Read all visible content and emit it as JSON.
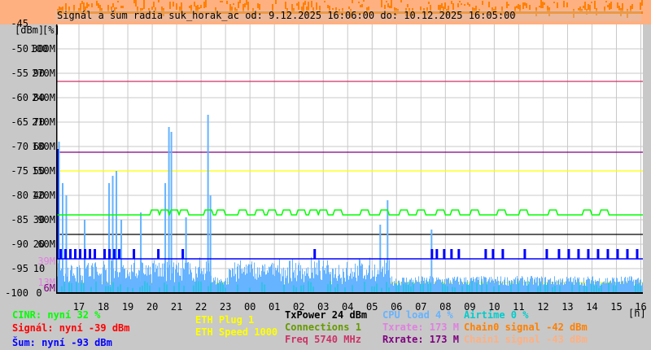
{
  "chart_data": {
    "type": "line",
    "title": "Signál a šum radia suk_horak_ac od: 9.12.2025 16:06:00 do: 10.12.2025 16:05:00",
    "axis_units": {
      "dbm": "[dBm]",
      "percent": "[%]",
      "x": "[h]"
    },
    "ylim_dbm": [
      -100,
      -45
    ],
    "ylim_percent": [
      0,
      110
    ],
    "ylim_rate_M": [
      0,
      330
    ],
    "y_ticks": [
      {
        "dbm": "-45",
        "pct": "",
        "rate": ""
      },
      {
        "dbm": "-50",
        "pct": "100",
        "rate": "300M"
      },
      {
        "dbm": "-55",
        "pct": "90",
        "rate": "270M"
      },
      {
        "dbm": "-60",
        "pct": "80",
        "rate": "240M"
      },
      {
        "dbm": "-65",
        "pct": "70",
        "rate": "210M"
      },
      {
        "dbm": "-70",
        "pct": "60",
        "rate": "180M"
      },
      {
        "dbm": "-75",
        "pct": "50",
        "rate": "150M"
      },
      {
        "dbm": "-80",
        "pct": "40",
        "rate": "120M"
      },
      {
        "dbm": "-85",
        "pct": "30",
        "rate": "90M"
      },
      {
        "dbm": "-90",
        "pct": "20",
        "rate": "60M"
      },
      {
        "dbm": "-95",
        "pct": "10",
        "rate": ""
      },
      {
        "dbm": "-100",
        "pct": "0",
        "rate": ""
      }
    ],
    "extra_rate_labels": [
      {
        "value": 39,
        "label": "39M",
        "color": "#e080e0"
      },
      {
        "value": 13,
        "label": "13M",
        "color": "#e080e0"
      },
      {
        "value": 6,
        "label": "6M",
        "color": "#800080"
      }
    ],
    "x_ticks": [
      "17",
      "18",
      "19",
      "20",
      "21",
      "22",
      "23",
      "00",
      "01",
      "02",
      "03",
      "04",
      "05",
      "06",
      "07",
      "08",
      "09",
      "10",
      "11",
      "12",
      "13",
      "14",
      "15",
      "16"
    ],
    "x_start_hour": 16.1,
    "x_end_hour": 40.083,
    "grid": true,
    "series": [
      {
        "name": "CINR",
        "unit": "%",
        "color": "#00ff00",
        "base": 32,
        "bumps_to": 34,
        "bump_hours": [
          19.9,
          20.3,
          20.7,
          21.1,
          22.1,
          22.6,
          23.5,
          24.2,
          24.7,
          25.3,
          25.9,
          26.4,
          26.8,
          27.4,
          28.5,
          29.3,
          30.1,
          30.8,
          31.6,
          32.2,
          33.0,
          34.1,
          35.0,
          36.2,
          37.6,
          38.3
        ]
      },
      {
        "name": "Šum",
        "unit": "dBm",
        "color": "#0000ff",
        "base": -93,
        "spike_to": -91,
        "spike_hours": [
          16.2,
          16.4,
          16.6,
          16.8,
          17.0,
          17.2,
          17.4,
          17.6,
          18.0,
          18.2,
          18.4,
          18.6,
          19.2,
          20.2,
          21.2,
          26.6,
          31.4,
          31.6,
          31.9,
          32.2,
          32.5,
          33.6,
          33.9,
          34.3,
          35.2,
          36.1,
          36.6,
          37.0,
          37.4,
          37.8,
          38.2,
          38.6,
          39.0,
          39.4,
          39.8
        ]
      },
      {
        "name": "CPU load",
        "unit": "%",
        "color": "#66b3ff",
        "base": 4,
        "spikes": [
          [
            16.15,
            62
          ],
          [
            16.3,
            45
          ],
          [
            16.45,
            40
          ],
          [
            17.2,
            30
          ],
          [
            18.2,
            45
          ],
          [
            18.35,
            48
          ],
          [
            18.5,
            50
          ],
          [
            18.7,
            30
          ],
          [
            19.5,
            33
          ],
          [
            20.5,
            45
          ],
          [
            20.65,
            68
          ],
          [
            20.75,
            66
          ],
          [
            21.35,
            31
          ],
          [
            22.25,
            73
          ],
          [
            22.35,
            40
          ],
          [
            29.3,
            28
          ],
          [
            29.6,
            38
          ],
          [
            31.4,
            26
          ]
        ]
      },
      {
        "name": "Airtime",
        "unit": "%",
        "color": "#00cccc",
        "base": 2
      },
      {
        "name": "Rxrate",
        "unit": "M",
        "color": "#800080",
        "value": 173
      },
      {
        "name": "Txrate",
        "unit": "M",
        "color": "#e080e0",
        "value": 173
      },
      {
        "name": "Freq",
        "unit": "MHz",
        "color": "#cc3366",
        "level_rate": 260
      },
      {
        "name": "ETH Speed",
        "color": "#ffff00",
        "level_rate": 150
      },
      {
        "name": "TxPower",
        "color": "#000000",
        "level_rate": 72
      },
      {
        "name": "ETH Plug",
        "color": "#ffff00",
        "level_rate": 13
      },
      {
        "name": "Connections",
        "color": "#669900",
        "level_rate": 3
      }
    ]
  },
  "legend": {
    "cinr": "CINR: nyní 32 %",
    "signal": "Signál: nyní -39 dBm",
    "noise": "Šum: nyní -93 dBm",
    "eth_plug": "ETH Plug 1",
    "eth_speed": "ETH Speed 1000",
    "txpower": "TxPower 24 dBm",
    "connections": "Connections 1",
    "freq": "Freq 5740 MHz",
    "cpu": "CPU load 4 %",
    "txrate": "Txrate: 173 M",
    "rxrate": "Rxrate: 173 M",
    "airtime": "Airtime 0 %",
    "chain0": "Chain0 signal -42 dBm",
    "chain1": "Chain1 signal -43 dBm"
  },
  "colors": {
    "cinr": "#00ff00",
    "signal": "#ff0000",
    "noise": "#0000ff",
    "eth": "#ffff00",
    "txpower": "#000000",
    "connections": "#669900",
    "freq": "#cc3366",
    "cpu": "#66b3ff",
    "txrate": "#e080e0",
    "rxrate": "#800080",
    "airtime": "#00cccc",
    "chain0": "#ff8000",
    "chain1": "#ffb080"
  }
}
